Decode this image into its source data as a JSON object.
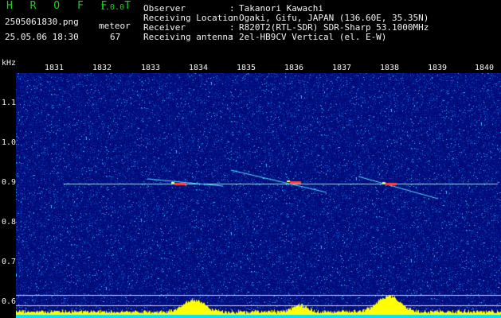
{
  "app": {
    "title": "H R O F F T",
    "version": "1.0.0"
  },
  "file": {
    "name": "2505061830.png",
    "datetime": "25.05.06 18:30"
  },
  "detection": {
    "mode": "meteor",
    "count": "67"
  },
  "info": [
    {
      "label": "Observer",
      "value": "Takanori Kawachi"
    },
    {
      "label": "Receiving Location",
      "value": "Ogaki, Gifu, JAPAN (136.60E, 35.35N)"
    },
    {
      "label": "Receiver",
      "value": "R820T2(RTL-SDR) SDR-Sharp 53.1000MHz"
    },
    {
      "label": "Receiving antenna",
      "value": "2el-HB9CV Vertical (el. E-W)"
    }
  ],
  "axis": {
    "unit": "kHz",
    "y_ticks": [
      "1.1",
      "1.0",
      "0.9",
      "0.8",
      "0.7",
      "0.6"
    ],
    "x_ticks": [
      "1831",
      "1832",
      "1833",
      "1834",
      "1835",
      "1836",
      "1837",
      "1838",
      "1839",
      "1840"
    ]
  },
  "colors": {
    "background": "#000000",
    "spectrogram_base": "#000a78",
    "carrier": "#80ff80",
    "text_green": "#19d219",
    "text_white": "#f2f2f2",
    "power_fill": "#ffff00",
    "power_base": "#00e0ff"
  }
}
